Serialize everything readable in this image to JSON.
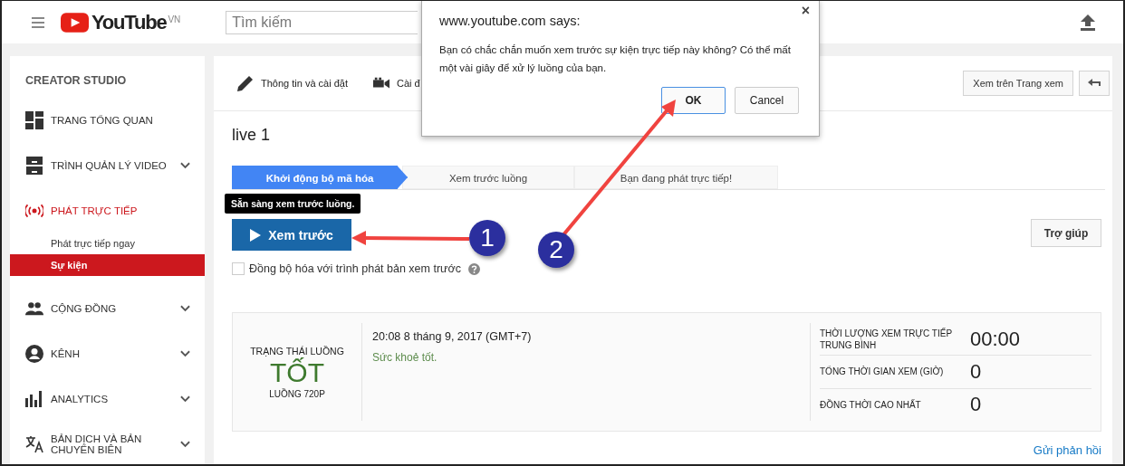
{
  "header": {
    "logo": "YouTube",
    "region": "VN",
    "search": {
      "placeholder": "Tìm kiếm"
    }
  },
  "sidebar": {
    "title": "CREATOR STUDIO",
    "items": [
      {
        "label": "TRANG TỔNG QUAN",
        "selected": false
      },
      {
        "label": "TRÌNH QUẢN LÝ VIDEO",
        "selected": false,
        "expanded": false
      },
      {
        "label": "PHÁT TRỰC TIẾP",
        "selected": true,
        "expanded": true,
        "children": [
          {
            "label": "Phát trực tiếp ngay",
            "selected": false
          },
          {
            "label": "Sự kiện",
            "selected": true
          }
        ]
      },
      {
        "label": "CỘNG ĐỒNG",
        "selected": false,
        "expanded": false
      },
      {
        "label": "KÊNH",
        "selected": false,
        "expanded": false
      },
      {
        "label": "ANALYTICS",
        "selected": false,
        "expanded": false
      },
      {
        "label": "BẢN DỊCH VÀ BẢN CHUYỂN BIÊN",
        "selected": false,
        "expanded": false
      }
    ]
  },
  "top_tabs": [
    {
      "label": "Thông tin và cài đặt"
    },
    {
      "label": "Cài đ"
    }
  ],
  "actions": {
    "watch_button": "Xem trên Trang xem"
  },
  "title": "live 1",
  "steps": [
    {
      "label": "Khởi động bộ mã hóa",
      "selected": true
    },
    {
      "label": "Xem trước luồng",
      "selected": false
    },
    {
      "label": "Bạn đang phát trực tiếp!",
      "selected": false
    }
  ],
  "tooltip": "Sẵn sàng xem trước luồng.",
  "preview_button": "Xem trước",
  "help_button": "Trợ giúp",
  "sync_checkbox": {
    "label": "Đồng bộ hóa với trình phát bản xem trước",
    "checked": false
  },
  "stats": {
    "status_label": "TRẠNG THÁI LUỒNG",
    "status_value": "TỐT",
    "status_sub": "LUỒNG 720P",
    "timestamp": "20:08 8 tháng 9, 2017 (GMT+7)",
    "health": "Sức khoẻ tốt.",
    "metrics": [
      {
        "label": "THỜI LƯỢNG XEM TRỰC TIẾP TRUNG BÌNH",
        "value": "00:00"
      },
      {
        "label": "TỔNG THỜI GIAN XEM (GIỜ)",
        "value": "0"
      },
      {
        "label": "ĐỒNG THỜI CAO NHẤT",
        "value": "0"
      }
    ]
  },
  "feedback_link": "Gửi phản hồi",
  "dialog": {
    "title": "www.youtube.com says:",
    "close": "×",
    "message": "Bạn có chắc chắn muốn xem trước sự kiện trực tiếp này không? Có thể mất một vài giây để xử lý luồng của bạn.",
    "buttons": [
      {
        "label": "OK",
        "selected": true
      },
      {
        "label": "Cancel",
        "selected": false
      }
    ]
  },
  "annotations": [
    {
      "number": "1"
    },
    {
      "number": "2"
    }
  ]
}
